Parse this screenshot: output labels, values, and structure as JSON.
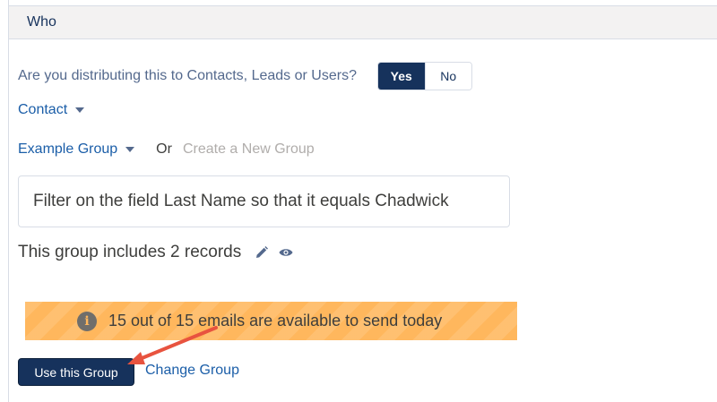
{
  "header": {
    "title": "Who"
  },
  "distribution": {
    "question": "Are you distributing this to Contacts, Leads or Users?",
    "yes_label": "Yes",
    "no_label": "No",
    "selected": "Yes"
  },
  "recipient_type": {
    "selected": "Contact"
  },
  "group": {
    "selected": "Example Group",
    "or_label": "Or",
    "create_label": "Create a New Group"
  },
  "filter": {
    "text": "Filter on the field Last Name so that it equals Chadwick"
  },
  "summary": {
    "text": "This group includes 2 records",
    "edit_icon": "pencil-icon",
    "view_icon": "eye-icon"
  },
  "banner": {
    "icon": "info-icon",
    "info_glyph": "i",
    "text": "15 out of 15 emails are available to send today",
    "color": "#ffb75d"
  },
  "actions": {
    "use_label": "Use this Group",
    "change_label": "Change Group"
  },
  "colors": {
    "brand_navy": "#16325c",
    "link_blue": "#1b5ea8",
    "annotation_arrow": "#e8533f"
  }
}
